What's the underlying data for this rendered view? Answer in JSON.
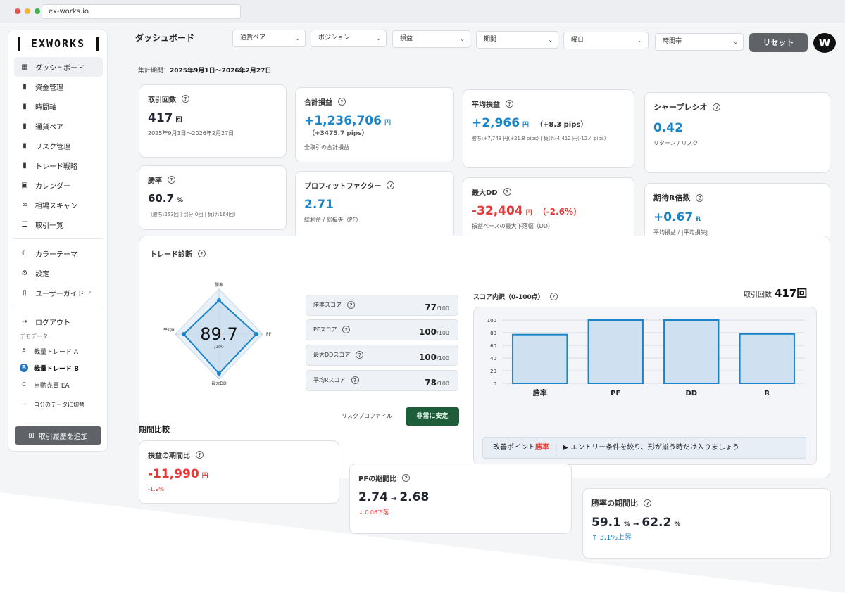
{
  "browser": {
    "url": "ex-works.io"
  },
  "sidebar": {
    "logo": "EXWORKS",
    "items": [
      {
        "label": "ダッシュボード",
        "icon": "grid-icon",
        "glyph": "▦"
      },
      {
        "label": "資金管理",
        "icon": "bar-chart-icon",
        "glyph": "▮"
      },
      {
        "label": "時間軸",
        "icon": "bar-chart-icon",
        "glyph": "▮"
      },
      {
        "label": "通貨ペア",
        "icon": "bar-chart-icon",
        "glyph": "▮"
      },
      {
        "label": "リスク管理",
        "icon": "bar-chart-icon",
        "glyph": "▮"
      },
      {
        "label": "トレード戦略",
        "icon": "bar-chart-icon",
        "glyph": "▮"
      },
      {
        "label": "カレンダー",
        "icon": "calendar-icon",
        "glyph": "▣"
      },
      {
        "label": "相場スキャン",
        "icon": "binoculars-icon",
        "glyph": "∞"
      },
      {
        "label": "取引一覧",
        "icon": "list-icon",
        "glyph": "☰"
      }
    ],
    "settings": [
      {
        "label": "カラーテーマ",
        "icon": "moon-icon",
        "glyph": "☾"
      },
      {
        "label": "設定",
        "icon": "wrench-icon",
        "glyph": "⚙"
      },
      {
        "label": "ユーザーガイド",
        "icon": "book-icon",
        "glyph": "▯"
      }
    ],
    "logout": "ログアウト",
    "demo_label": "デモデータ",
    "demo_items": [
      {
        "badge": "A",
        "label": "裁量トレード A"
      },
      {
        "badge": "B",
        "label": "裁量トレード B"
      },
      {
        "badge": "C",
        "label": "自動売買 EA"
      }
    ],
    "switch_label": "自分のデータに切替",
    "add_button": "取引履歴を追加"
  },
  "header": {
    "title": "ダッシュボード",
    "filters": [
      "通貨ペア",
      "ポジション",
      "損益",
      "期間",
      "曜日",
      "時間帯"
    ],
    "reset": "リセット",
    "avatar": "W"
  },
  "period": {
    "label": "集計期間：",
    "value": "2025年9月1日〜2026年2月27日"
  },
  "kpis": {
    "trades": {
      "title": "取引回数",
      "value": "417",
      "unit": "回",
      "sub": "2025年9月1日〜2026年2月27日"
    },
    "total_pl": {
      "title": "合計損益",
      "value": "+1,236,706",
      "unit": "円",
      "pips": "（+3475.7 pips）",
      "sub": "全取引の合計損益"
    },
    "avg_pl": {
      "title": "平均損益",
      "value": "+2,966",
      "unit": "円",
      "pips": "（+8.3 pips）",
      "sub": "勝ち:+7,748 円(+21.8 pips) | 負け:-4,412 円(-12.4 pips)"
    },
    "sharpe": {
      "title": "シャープレシオ",
      "value": "0.42",
      "sub": "リターン / リスク"
    },
    "winrate": {
      "title": "勝率",
      "value": "60.7",
      "unit": "%",
      "sub": "（勝ち:253回 | 引分:0回 | 負け:164回）"
    },
    "pf": {
      "title": "プロフィットファクター",
      "value": "2.71",
      "sub": "総利益 / 総損失（PF）"
    },
    "maxdd": {
      "title": "最大DD",
      "value": "-32,404",
      "unit": "円",
      "pct": "（-2.6%）",
      "sub": "損益ベースの最大下落幅（DD）"
    },
    "expected_r": {
      "title": "期待R倍数",
      "value": "+0.67",
      "unit": "R",
      "sub": "平均損益 / |平均損失|"
    }
  },
  "diagnosis": {
    "title": "トレード診断",
    "score": "89.7",
    "score_unit": "/100",
    "axes": [
      "勝率",
      "PF",
      "最大DD",
      "平均R"
    ],
    "scores": [
      {
        "label": "勝率スコア",
        "value": "77",
        "unit": "/100"
      },
      {
        "label": "PFスコア",
        "value": "100",
        "unit": "/100"
      },
      {
        "label": "最大DDスコア",
        "value": "100",
        "unit": "/100"
      },
      {
        "label": "平均Rスコア",
        "value": "78",
        "unit": "/100"
      }
    ],
    "risk_label": "リスクプロファイル",
    "risk_value": "非常に安定",
    "breakdown_title": "スコア内訳（0-100点）",
    "trade_count_label": "取引回数",
    "trade_count_value": "417回",
    "improve_label": "改善ポイント",
    "improve_hl": "勝率",
    "improve_text": "▶ エントリー条件を絞り、形が揃う時だけ入りましょう"
  },
  "chart_data": {
    "type": "bar",
    "categories": [
      "勝率",
      "PF",
      "DD",
      "R"
    ],
    "values": [
      77,
      100,
      100,
      78
    ],
    "ylim": [
      0,
      100
    ],
    "yticks": [
      0,
      20,
      40,
      60,
      80,
      100
    ],
    "grid": true,
    "title": "",
    "xlabel": "",
    "ylabel": ""
  },
  "compare": {
    "title": "期間比較",
    "pl": {
      "title": "損益の期間比",
      "value": "-11,990",
      "unit": "円",
      "sub": "-1.9%"
    },
    "pf": {
      "title": "PFの期間比",
      "from": "2.74",
      "to": "2.68",
      "sub": "↓ 0.06下落"
    },
    "winrate": {
      "title": "勝率の期間比",
      "from": "59.1",
      "to": "62.2",
      "unit": "%",
      "sub": "↑ 3.1%上昇"
    }
  },
  "colors": {
    "accent_blue": "#1a84c7",
    "negative_red": "#e53935",
    "bar_fill": "#cfe1f1",
    "bar_stroke": "#1a84c7",
    "risk_green": "#1f5c3a"
  }
}
